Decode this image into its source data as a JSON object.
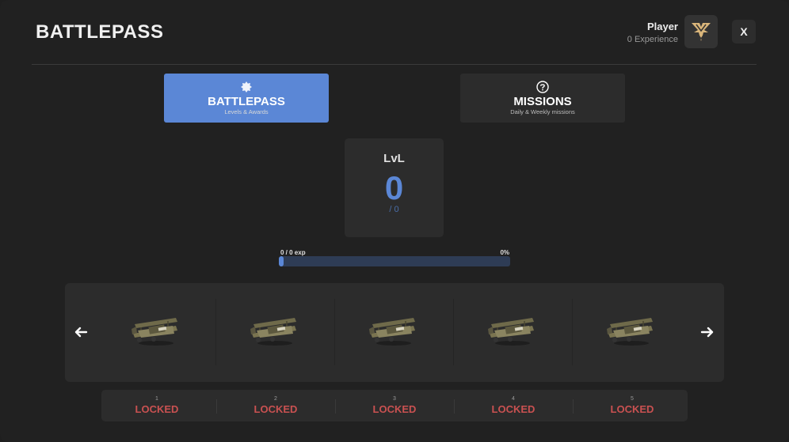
{
  "header": {
    "title": "BATTLEPASS",
    "player_name": "Player",
    "player_exp": "0 Experience",
    "close_label": "X"
  },
  "tabs": [
    {
      "label": "BATTLEPASS",
      "sub": "Levels & Awards",
      "icon": "badge-icon",
      "active": true
    },
    {
      "label": "MISSIONS",
      "sub": "Daily & Weekly missions",
      "icon": "question-circle-icon",
      "active": false
    }
  ],
  "level": {
    "label": "LvL",
    "value": "0",
    "sub": "/ 0"
  },
  "progress": {
    "left_text": "0 / 0 exp",
    "right_text": "0%",
    "fill_fraction": 0.02
  },
  "rewards": [
    {
      "name": "biplane",
      "number": "1",
      "status": "LOCKED"
    },
    {
      "name": "biplane",
      "number": "2",
      "status": "LOCKED"
    },
    {
      "name": "biplane",
      "number": "3",
      "status": "LOCKED"
    },
    {
      "name": "biplane",
      "number": "4",
      "status": "LOCKED"
    },
    {
      "name": "biplane",
      "number": "5",
      "status": "LOCKED"
    }
  ],
  "colors": {
    "accent": "#5b87d6",
    "locked": "#c95151",
    "panel": "#2c2c2c",
    "background": "#212121"
  }
}
